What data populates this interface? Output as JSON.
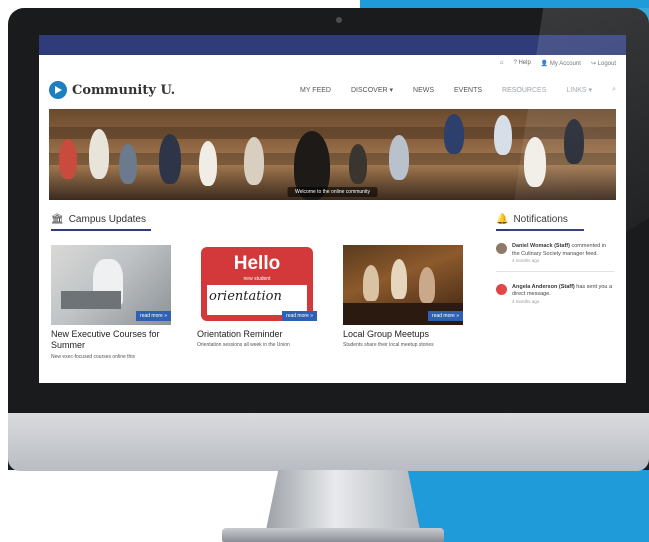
{
  "utility": {
    "home_icon": "home-icon",
    "help": "? Help",
    "account": "My Account",
    "logout": "Logout"
  },
  "brand": {
    "name": "Community U."
  },
  "menu": {
    "items": [
      "MY FEED",
      "DISCOVER",
      "NEWS",
      "EVENTS",
      "RESOURCES",
      "LINKS"
    ]
  },
  "hero": {
    "caption": "Welcome to the online community"
  },
  "updates": {
    "title": "Campus Updates",
    "cards": [
      {
        "title": "New Executive Courses for Summer",
        "desc": "New exec-focused courses online this",
        "readmore": "read more »"
      },
      {
        "title": "Orientation Reminder",
        "desc": "Orientation sessions all week in the Union",
        "readmore": "read more »",
        "sign_big": "Hello",
        "sign_small": "new student",
        "sign_script": "orientation"
      },
      {
        "title": "Local Group Meetups",
        "desc": "Students share their local meetup stories",
        "readmore": "read more »"
      }
    ]
  },
  "notifications": {
    "title": "Notifications",
    "items": [
      {
        "name": "Daniel Womack (Staff)",
        "text": "commented in the Culinary Society manager feed.",
        "time": "4 months ago"
      },
      {
        "name": "Angela Anderson (Staff)",
        "text": "has sent you a direct message.",
        "time": "4 months ago"
      }
    ]
  },
  "colors": {
    "brand_navy": "#2f3c79",
    "accent_blue": "#1e9bd8",
    "readmore": "#2f60b4",
    "hello_red": "#d3383a"
  }
}
